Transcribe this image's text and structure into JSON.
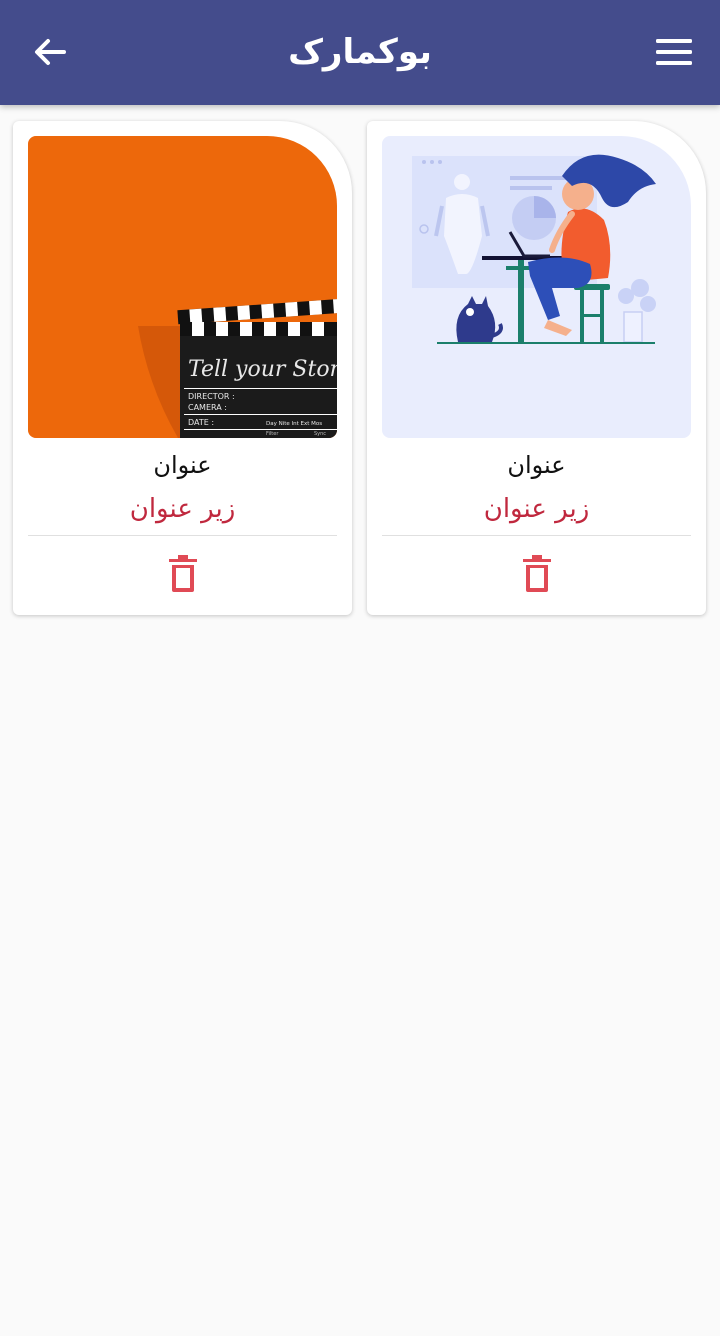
{
  "appbar": {
    "title": "بوکمارک",
    "back_icon": "arrow-left-icon",
    "menu_icon": "hamburger-menu-icon",
    "background": "#444c8c"
  },
  "bookmarks": [
    {
      "title": "عنوان",
      "subtitle": "زیر عنوان",
      "image": "illustration-woman-laptop-cat",
      "delete_icon": "trash-icon"
    },
    {
      "title": "عنوان",
      "subtitle": "زیر عنوان",
      "image": "photo-clapperboard-orange",
      "image_text": "Tell your Story",
      "slate_labels": [
        "DIRECTOR :",
        "CAMERA :",
        "DATE :",
        "Day Nite Int Ext Mos",
        "Filter",
        "Sync"
      ],
      "delete_icon": "trash-icon"
    }
  ],
  "colors": {
    "accent": "#444c8c",
    "subtitle": "#c0283e",
    "delete": "#e04a55"
  }
}
